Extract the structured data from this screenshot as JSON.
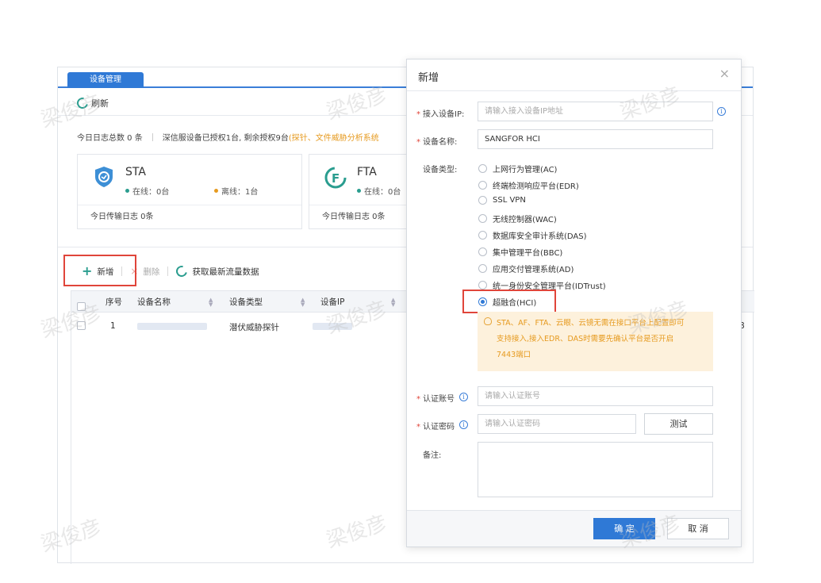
{
  "app": {
    "tab_label": "设备管理",
    "refresh_label": "刷新",
    "summary": {
      "total_logs": "今日日志总数 0 条",
      "license": "深信服设备已授权1台, 剩余授权9台",
      "warn": "(探针、文件威胁分析系统"
    },
    "cards": [
      {
        "name": "STA",
        "online": "在线：0台",
        "offline": "离线：1台",
        "today_logs": "今日传输日志 0条"
      },
      {
        "name": "FTA",
        "online": "在线：0台",
        "today_logs": "今日传输日志 0条"
      }
    ],
    "toolbar": {
      "add": "新增",
      "delete": "删除",
      "fetch": "获取最新流量数据"
    },
    "table": {
      "headers": [
        "序号",
        "设备名称",
        "设备类型",
        "设备IP"
      ],
      "rows": [
        {
          "index": "1",
          "type": "潜伏威胁探针"
        }
      ],
      "right_edge_text": "8"
    }
  },
  "dialog": {
    "title": "新增",
    "close": "×",
    "ip": {
      "label": "接入设备IP:",
      "placeholder": "请输入接入设备IP地址"
    },
    "name": {
      "label": "设备名称:",
      "value": "SANGFOR HCI"
    },
    "type_label": "设备类型:",
    "types": [
      {
        "label": "上网行为管理(AC)",
        "checked": false
      },
      {
        "label": "终端检测响应平台(EDR)",
        "checked": false
      },
      {
        "label": "SSL VPN",
        "checked": false
      },
      {
        "label": "无线控制器(WAC)",
        "checked": false
      },
      {
        "label": "数据库安全审计系统(DAS)",
        "checked": false
      },
      {
        "label": "集中管理平台(BBC)",
        "checked": false
      },
      {
        "label": "应用交付管理系统(AD)",
        "checked": false
      },
      {
        "label": "统一身份安全管理平台(IDTrust)",
        "checked": false
      },
      {
        "label": "超融合(HCI)",
        "checked": true
      }
    ],
    "notice": [
      "STA、AF、FTA、云眼、云镜无需在接口平台上配置即可",
      "支持接入,接入EDR、DAS时需要先确认平台是否开启",
      "7443端口"
    ],
    "account": {
      "label": "认证账号",
      "placeholder": "请输入认证账号"
    },
    "password": {
      "label": "认证密码",
      "placeholder": "请输入认证密码"
    },
    "test": "测试",
    "remark": {
      "label": "备注:"
    },
    "ok": "确 定",
    "cancel": "取 消"
  },
  "watermark": "梁俊彦",
  "colors": {
    "primary": "#2f79d6",
    "highlight": "#e0453a",
    "warn": "#e69a1f",
    "online": "#2a9d8f"
  }
}
